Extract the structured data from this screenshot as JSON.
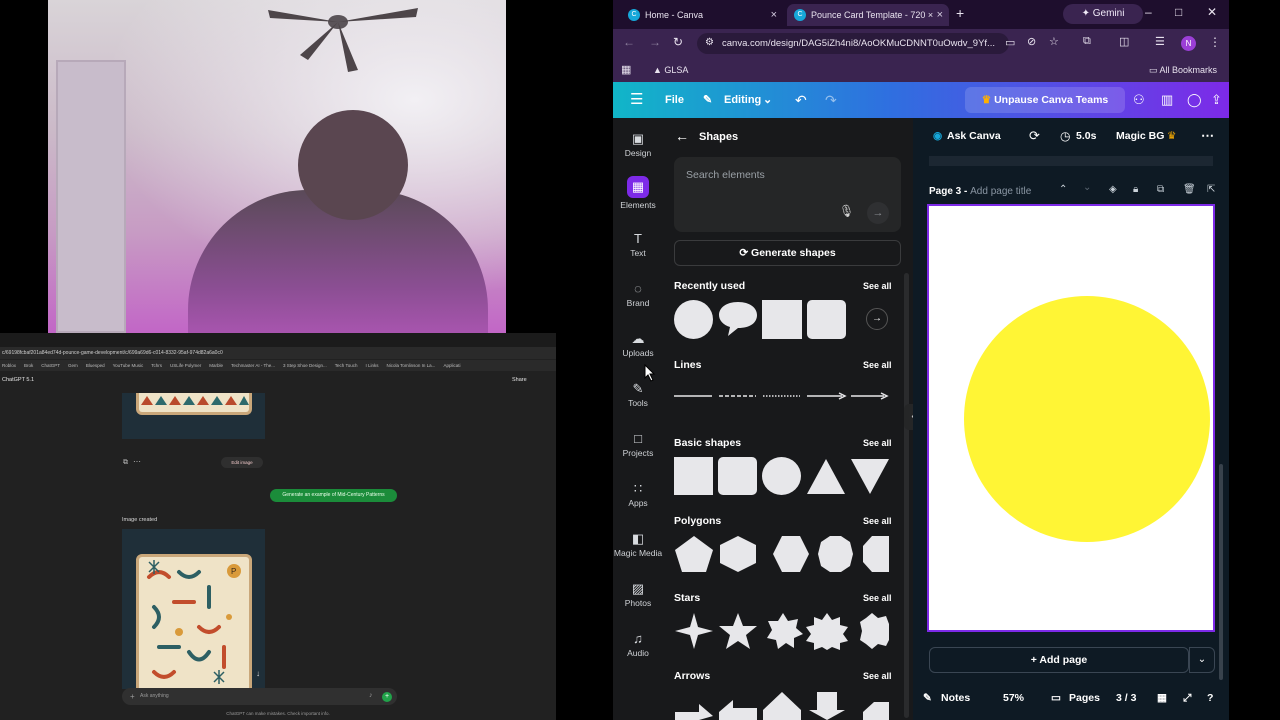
{
  "chatgpt": {
    "url": "c/69198fcbaf201a84ed74d-pounce-game-development/c/699a69d6-c014-8332-95af-974d82a6a0c0",
    "bookmarks": [
      "Roblox",
      "Brok",
      "ChatGPT",
      "Gem",
      "Bluesped",
      "YouTube Music",
      "Tchrs",
      "USLife Polymer",
      "Marble",
      "Techmaster AI - The...",
      "3 Step Shoe Design...",
      "Tech Touch",
      "I Links",
      "Nicola Tomlinson In La...",
      "Applicati"
    ],
    "model_label": "ChatGPT 5.1",
    "share_label": "Share",
    "edit_image_label": "Edit image",
    "user_message": "Generate an example of Mid-Century Patterns",
    "image_created_label": "Image created",
    "composer_placeholder": "Ask anything",
    "disclaimer": "ChatGPT can make mistakes. Check important info."
  },
  "browser": {
    "tabs": [
      {
        "label": "Home - Canva",
        "active": false
      },
      {
        "label": "Pounce Card Template - 720 ×",
        "active": true
      }
    ],
    "new_tab": "+",
    "gemini_label": "Gemini",
    "url": "canva.com/design/DAG5iZh4ni8/AoOKMuCDNNT0uOwdv_9Yf...",
    "profile_initial": "N",
    "bookmark_folder": "GLSA",
    "all_bookmarks": "All Bookmarks"
  },
  "canva": {
    "header": {
      "file_label": "File",
      "editing_label": "Editing",
      "unpause_label": "Unpause Canva Teams"
    },
    "rail": [
      {
        "label": "Design",
        "icon": "design-icon",
        "glyph": "▣"
      },
      {
        "label": "Elements",
        "icon": "elements-icon",
        "glyph": "▦",
        "active": true
      },
      {
        "label": "Text",
        "icon": "text-icon",
        "glyph": "T"
      },
      {
        "label": "Brand",
        "icon": "brand-icon",
        "glyph": "◌"
      },
      {
        "label": "Uploads",
        "icon": "uploads-icon",
        "glyph": "☁"
      },
      {
        "label": "Tools",
        "icon": "tools-icon",
        "glyph": "✎"
      },
      {
        "label": "Projects",
        "icon": "projects-icon",
        "glyph": "□"
      },
      {
        "label": "Apps",
        "icon": "apps-icon",
        "glyph": "∷"
      },
      {
        "label": "Magic Media",
        "icon": "magic-media-icon",
        "glyph": "◧"
      },
      {
        "label": "Photos",
        "icon": "photos-icon",
        "glyph": "▨"
      },
      {
        "label": "Audio",
        "icon": "audio-icon",
        "glyph": "♫"
      }
    ],
    "panel": {
      "title": "Shapes",
      "search_placeholder": "Search elements",
      "generate_label": "Generate shapes",
      "see_all": "See all",
      "sections": {
        "recently_used": "Recently used",
        "lines": "Lines",
        "basic_shapes": "Basic shapes",
        "polygons": "Polygons",
        "stars": "Stars",
        "arrows": "Arrows"
      }
    },
    "toolbar": {
      "ask_canva": "Ask Canva",
      "timer": "5.0s",
      "magic_bg": "Magic BG"
    },
    "page": {
      "label": "Page 3 -",
      "title_placeholder": "Add page title",
      "circle_color": "#fff535"
    },
    "add_page_label": "+ Add page",
    "footer": {
      "notes_label": "Notes",
      "zoom": "57%",
      "pages_label": "Pages",
      "page_count": "3 / 3"
    }
  },
  "colors": {
    "canva_purple": "#7d2ae8",
    "canva_teal": "#11b6c8",
    "chat_green": "#1b8c3a"
  }
}
